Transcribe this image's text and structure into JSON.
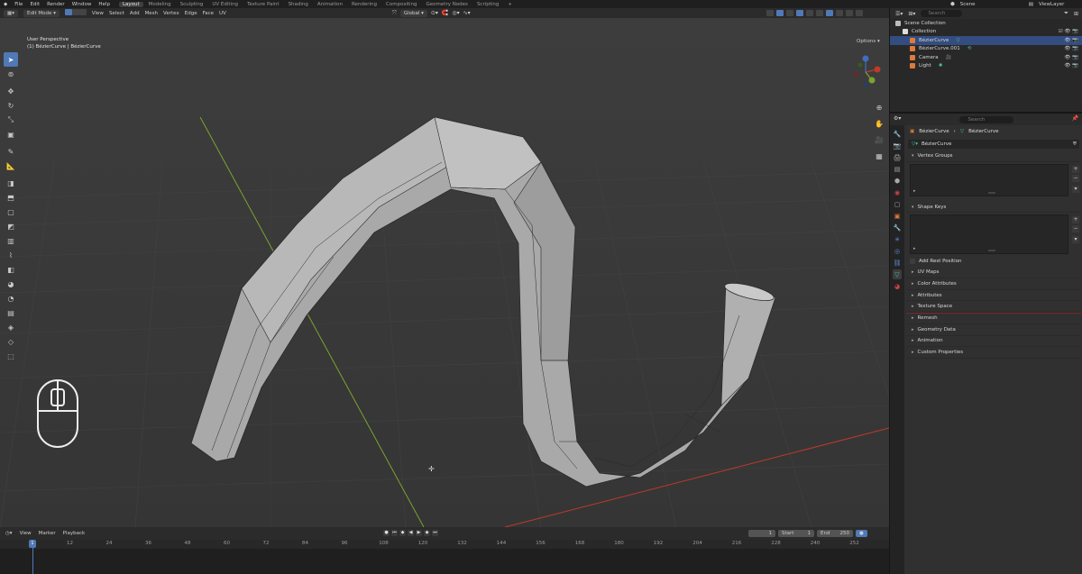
{
  "top_menu": {
    "items": [
      "File",
      "Edit",
      "Render",
      "Window",
      "Help"
    ],
    "workspaces": [
      "Layout",
      "Modeling",
      "Sculpting",
      "UV Editing",
      "Texture Paint",
      "Shading",
      "Animation",
      "Rendering",
      "Compositing",
      "Geometry Nodes",
      "Scripting",
      "+"
    ],
    "active_workspace": "Layout",
    "scene": "Scene",
    "view_layer": "ViewLayer"
  },
  "viewport_header": {
    "mode": "Edit Mode",
    "menus": [
      "View",
      "Select",
      "Add",
      "Mesh",
      "Vertex",
      "Edge",
      "Face",
      "UV"
    ],
    "orientation": "Global",
    "options": "Options"
  },
  "viewport": {
    "perspective": "User Perspective",
    "object_info": "(1) BézierCurve | BézierCurve"
  },
  "timeline": {
    "menus": [
      "View",
      "Marker",
      "Playback"
    ],
    "current_frame": "1",
    "start_label": "Start",
    "start": "1",
    "end_label": "End",
    "end": "250",
    "ruler": [
      "1",
      "12",
      "24",
      "36",
      "48",
      "60",
      "72",
      "84",
      "96",
      "108",
      "120",
      "132",
      "144",
      "156",
      "168",
      "180",
      "192",
      "204",
      "216",
      "228",
      "240",
      "252"
    ],
    "playhead": "1"
  },
  "outliner": {
    "search_placeholder": "Search",
    "rows": [
      {
        "label": "Scene Collection"
      },
      {
        "label": "Collection"
      },
      {
        "label": "BézierCurve"
      },
      {
        "label": "BézierCurve.001"
      },
      {
        "label": "Camera"
      },
      {
        "label": "Light"
      }
    ]
  },
  "properties": {
    "search_placeholder": "Search",
    "breadcrumb_object": "BézierCurve",
    "breadcrumb_data": "BézierCurve",
    "datablock": "BézierCurve",
    "panels": {
      "vertex_groups": "Vertex Groups",
      "shape_keys": "Shape Keys",
      "add_rest_position": "Add Rest Position",
      "uv_maps": "UV Maps",
      "color_attributes": "Color Attributes",
      "attributes": "Attributes",
      "texture_space": "Texture Space",
      "remesh": "Remesh",
      "geometry_data": "Geometry Data",
      "animation": "Animation",
      "custom_properties": "Custom Properties"
    }
  },
  "colors": {
    "accent": "#4f79b7",
    "x_axis": "#c0392b",
    "y_axis": "#7aa32e",
    "mesh": "#a9a9a9"
  }
}
